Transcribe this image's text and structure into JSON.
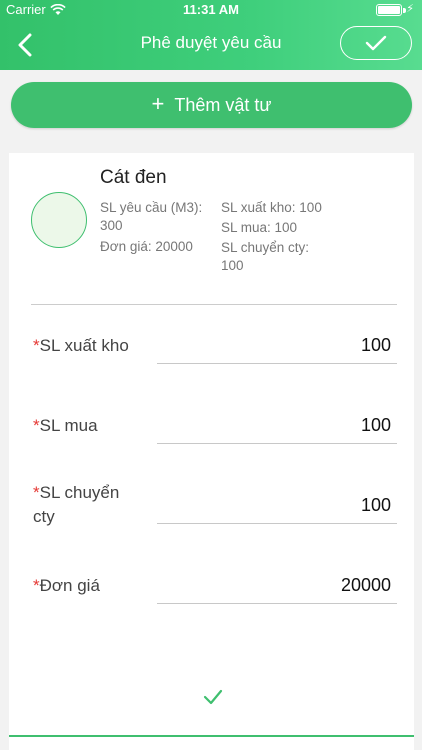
{
  "status_bar": {
    "carrier": "Carrier",
    "time": "11:31 AM"
  },
  "header": {
    "title": "Phê duyệt yêu cầu"
  },
  "add_material": {
    "label": "Thêm vật tư"
  },
  "item": {
    "name": "Cát đen",
    "requested_qty_label": "SL yêu cầu (M3):",
    "requested_qty_value": "300",
    "unit_price": "Đơn giá: 20000",
    "export_qty": "SL xuất kho: 100",
    "purchase_qty": "SL mua: 100",
    "transfer_qty_label": "SL chuyển cty:",
    "transfer_qty_value": "100"
  },
  "fields": {
    "export_stock": {
      "label": "SL xuất kho",
      "value": "100"
    },
    "purchase": {
      "label": "SL mua",
      "value": "100"
    },
    "transfer": {
      "label": "SL chuyển cty",
      "value": "100"
    },
    "unit_price": {
      "label": "Đơn giá",
      "value": "20000"
    }
  },
  "colors": {
    "primary": "#3fbf6f",
    "required": "#e53935"
  },
  "icons": {
    "back": "chevron-left-icon",
    "confirm": "check-icon",
    "add": "plus-icon",
    "bottom": "check-icon"
  }
}
